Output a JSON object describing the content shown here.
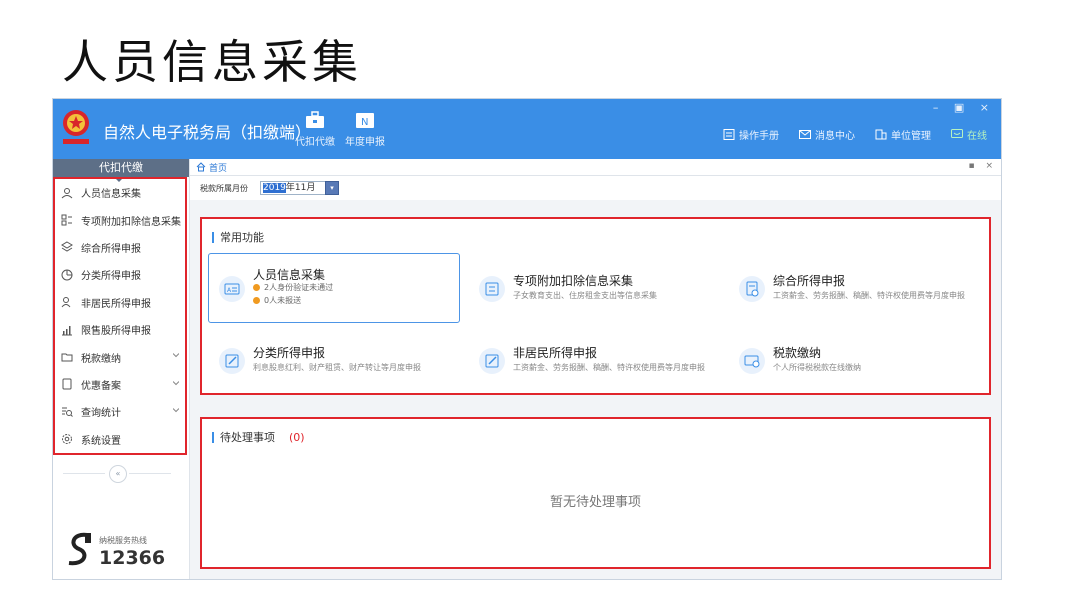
{
  "slide_title": "人员信息采集",
  "app": {
    "title": "自然人电子税务局（扣缴端）",
    "window_controls": "– ▣ ×",
    "toolbar": [
      {
        "label": "代扣代缴",
        "icon": "briefcase-icon"
      },
      {
        "label": "年度申报",
        "icon": "annual-report-icon"
      }
    ],
    "top_links": [
      {
        "label": "操作手册",
        "icon": "manual-icon"
      },
      {
        "label": "消息中心",
        "icon": "mail-icon"
      },
      {
        "label": "单位管理",
        "icon": "org-icon"
      },
      {
        "label": "在线",
        "icon": "online-icon"
      }
    ]
  },
  "sidebar": {
    "header": "代扣代缴",
    "items": [
      {
        "label": "人员信息采集",
        "icon": "person-icon",
        "expandable": false
      },
      {
        "label": "专项附加扣除信息采集",
        "icon": "list-icon",
        "expandable": false
      },
      {
        "label": "综合所得申报",
        "icon": "layers-icon",
        "expandable": false
      },
      {
        "label": "分类所得申报",
        "icon": "pie-icon",
        "expandable": false
      },
      {
        "label": "非居民所得申报",
        "icon": "person-outline-icon",
        "expandable": false
      },
      {
        "label": "限售股所得申报",
        "icon": "bar-chart-icon",
        "expandable": false
      },
      {
        "label": "税款缴纳",
        "icon": "folder-icon",
        "expandable": true
      },
      {
        "label": "优惠备案",
        "icon": "document-icon",
        "expandable": true
      },
      {
        "label": "查询统计",
        "icon": "query-icon",
        "expandable": true
      },
      {
        "label": "系统设置",
        "icon": "gear-icon",
        "expandable": false
      }
    ],
    "collapse": "«",
    "hotline_label": "纳税服务热线",
    "hotline_number": "12366"
  },
  "main": {
    "tab": "首页",
    "tab_controls": "▪ ×",
    "period_label": "税款所属月份",
    "period_year": "2019",
    "period_month": "年11月",
    "common_title": "常用功能",
    "cards": [
      {
        "title": "人员信息采集",
        "lines": [
          "2人身份验证未通过",
          "0人未报送"
        ],
        "icon": "id-card-icon"
      },
      {
        "title": "专项附加扣除信息采集",
        "desc": "子女教育支出、住房租金支出等信息采集",
        "icon": "deduction-icon"
      },
      {
        "title": "综合所得申报",
        "desc": "工资薪金、劳务报酬、稿酬、特许权使用费等月度申报",
        "icon": "report-icon"
      },
      {
        "title": "分类所得申报",
        "desc": "利息股息红利、财产租赁、财产转让等月度申报",
        "icon": "edit-icon"
      },
      {
        "title": "非居民所得申报",
        "desc": "工资薪金、劳务报酬、稿酬、特许权使用费等月度申报",
        "icon": "edit-icon"
      },
      {
        "title": "税款缴纳",
        "desc": "个人所得税税款在线缴纳",
        "icon": "payment-icon"
      }
    ],
    "pending_title": "待处理事项",
    "pending_count": "(0)",
    "pending_empty": "暂无待处理事项"
  }
}
